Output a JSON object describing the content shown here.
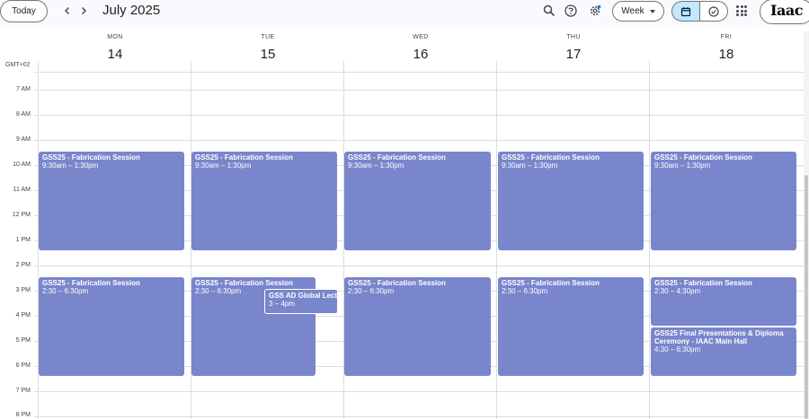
{
  "header": {
    "today_label": "Today",
    "month_title": "July 2025",
    "view_select": "Week",
    "logo_text": "Iaac",
    "icons": [
      "chevron-left-icon",
      "chevron-right-icon",
      "search-icon",
      "help-icon",
      "settings-icon",
      "calendar-icon",
      "tasks-icon",
      "apps-icon"
    ]
  },
  "timezone": "GMT+02",
  "days": [
    {
      "dow": "MON",
      "date": "14"
    },
    {
      "dow": "TUE",
      "date": "15"
    },
    {
      "dow": "WED",
      "date": "16"
    },
    {
      "dow": "THU",
      "date": "17"
    },
    {
      "dow": "FRI",
      "date": "18"
    }
  ],
  "hours": [
    "7 AM",
    "8 AM",
    "9 AM",
    "10 AM",
    "11 AM",
    "12 PM",
    "1 PM",
    "2 PM",
    "3 PM",
    "4 PM",
    "5 PM",
    "6 PM",
    "7 PM",
    "8 PM"
  ],
  "events": {
    "mon_am": {
      "title": "GSS25 - Fabrication Session",
      "time": "9:30am – 1:30pm"
    },
    "tue_am": {
      "title": "GSS25 - Fabrication Session",
      "time": "9:30am – 1:30pm"
    },
    "wed_am": {
      "title": "GSS25 - Fabrication Session",
      "time": "9:30am – 1:30pm"
    },
    "thu_am": {
      "title": "GSS25 - Fabrication Session",
      "time": "9:30am – 1:30pm"
    },
    "fri_am": {
      "title": "GSS25 - Fabrication Session",
      "time": "9:30am – 1:30pm"
    },
    "mon_pm": {
      "title": "GSS25 - Fabrication Session",
      "time": "2:30 – 6:30pm"
    },
    "tue_pm": {
      "title": "GSS25 - Fabrication Session",
      "time": "2:30 – 6:30pm"
    },
    "tue_lecture": {
      "title": "GSS AD Global Lecture",
      "time": "3 – 4pm"
    },
    "wed_pm": {
      "title": "GSS25 - Fabrication Session",
      "time": "2:30 – 6:30pm"
    },
    "thu_pm": {
      "title": "GSS25 - Fabrication Session",
      "time": "2:30 – 6:30pm"
    },
    "fri_pm": {
      "title": "GSS25 - Fabrication Session",
      "time": "2:30 – 4:30pm"
    },
    "fri_final": {
      "title": "GSS25 Final Presentations & Diploma Ceremony - IAAC Main Hall",
      "time": "4:30 – 6:30pm"
    }
  },
  "colors": {
    "event": "#7986cb",
    "accent_selected": "#c2e7ff"
  }
}
